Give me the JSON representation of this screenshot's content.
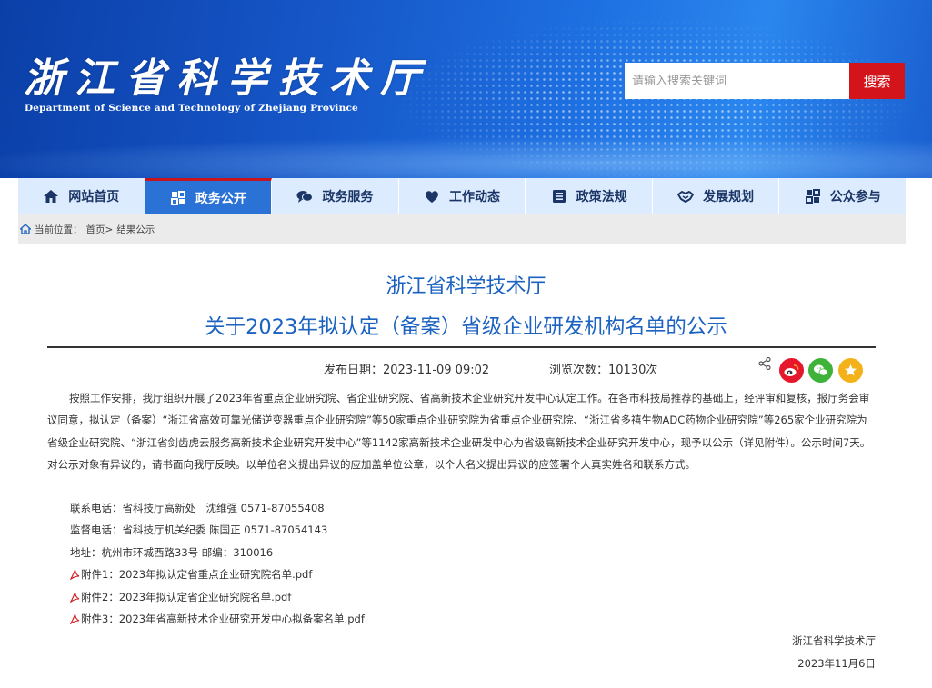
{
  "header": {
    "logo_cn": "浙江省科学技术厅",
    "logo_en": "Department of Science and Technology of Zhejiang Province",
    "search_placeholder": "请输入搜索关键词",
    "search_button": "搜索"
  },
  "nav": {
    "items": [
      {
        "label": "网站首页",
        "icon": "home-icon"
      },
      {
        "label": "政务公开",
        "icon": "gov-open-icon",
        "active": true
      },
      {
        "label": "政务服务",
        "icon": "chat-icon"
      },
      {
        "label": "工作动态",
        "icon": "heart-icon"
      },
      {
        "label": "政策法规",
        "icon": "list-icon"
      },
      {
        "label": "发展规划",
        "icon": "handshake-icon"
      },
      {
        "label": "公众参与",
        "icon": "participate-icon"
      }
    ]
  },
  "breadcrumb": {
    "prefix": "当前位置：",
    "home": "首页>",
    "current": "结果公示"
  },
  "article": {
    "site_title": "浙江省科学技术厅",
    "title": "关于2023年拟认定（备案）省级企业研发机构名单的公示",
    "publish_date": "发布日期：2023-11-09 09:02",
    "views": "浏览次数：10130次",
    "body": "按照工作安排，我厅组织开展了2023年省重点企业研究院、省企业研究院、省高新技术企业研究开发中心认定工作。在各市科技局推荐的基础上，经评审和复核，报厅务会审议同意，拟认定（备案）“浙江省高效可靠光储逆变器重点企业研究院”等50家重点企业研究院为省重点企业研究院、“浙江省多禧生物ADC药物企业研究院”等265家企业研究院为省级企业研究院、“浙江省剑齿虎云服务高新技术企业研究开发中心”等1142家高新技术企业研发中心为省级高新技术企业研究开发中心，现予以公示（详见附件）。公示时间7天。对公示对象有异议的，请书面向我厅反映。以单位名义提出异议的应加盖单位公章，以个人名义提出异议的应签署个人真实姓名和联系方式。",
    "contact": "联系电话：省科技厅高新处　沈维强 0571-87055408",
    "supervise": "监督电话：省科技厅机关纪委  陈国正 0571-87054143",
    "address": "地址：杭州市环城西路33号   邮编：310016",
    "attachments": [
      "附件1：2023年拟认定省重点企业研究院名单.pdf",
      "附件2：2023年拟认定省企业研究院名单.pdf",
      "附件3：2023年省高新技术企业研究开发中心拟备案名单.pdf"
    ],
    "signature": "浙江省科学技术厅",
    "sign_date": "2023年11月6日"
  },
  "share": {
    "items": [
      "weibo-icon",
      "wechat-icon",
      "favorite-icon"
    ],
    "colors": {
      "weibo": "#e6162d",
      "wechat": "#3fb23a",
      "favorite": "#f3b21a"
    }
  },
  "colors": {
    "accent_blue": "#1c62c1",
    "nav_active": "#2b72d6",
    "search_red": "#d3141b"
  }
}
